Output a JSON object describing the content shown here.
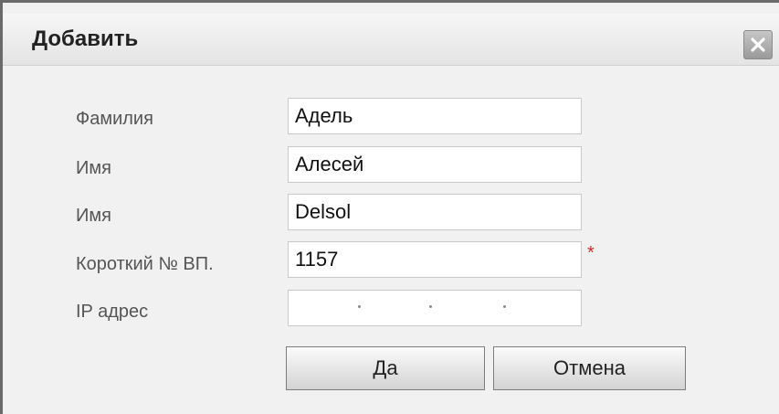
{
  "dialog": {
    "title": "Добавить",
    "close_icon": "close-icon"
  },
  "form": {
    "fields": [
      {
        "label": "Фамилия",
        "value": "Адель"
      },
      {
        "label": "Имя",
        "value": "Алесей"
      },
      {
        "label": "Имя",
        "value": "Delsol"
      },
      {
        "label": "Короткий № ВП.",
        "value": "1157",
        "required_mark": "*"
      },
      {
        "label": "IP адрес",
        "value": ""
      }
    ]
  },
  "buttons": {
    "ok": "Да",
    "cancel": "Отмена"
  },
  "colors": {
    "required": "#d42a2a",
    "dialog_bg": "#f1f1f1",
    "close_button": "#a8a8a8"
  }
}
